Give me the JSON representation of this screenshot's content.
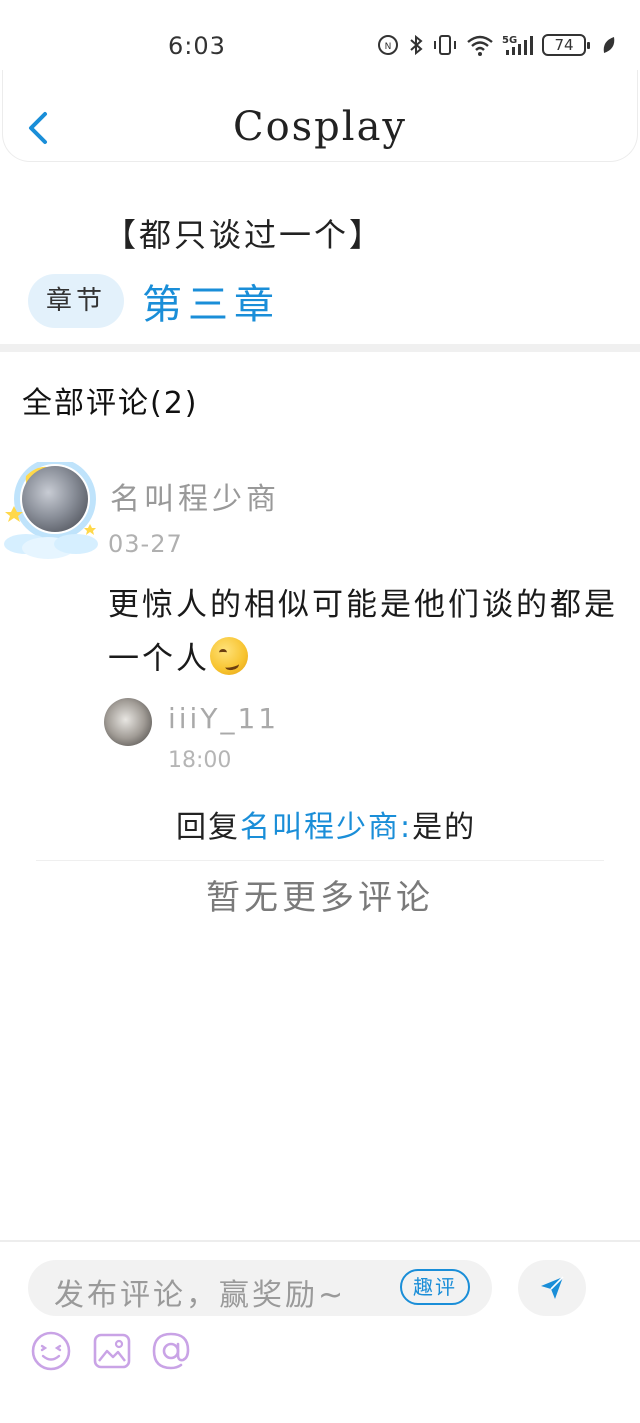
{
  "status_bar": {
    "time": "6:03",
    "battery": "74",
    "network": "5G"
  },
  "header": {
    "title": "Cosplay",
    "back_icon": "chevron-left-icon"
  },
  "book": {
    "title": "【都只谈过一个】",
    "chapter_tag": "章节",
    "chapter_name": "第三章"
  },
  "comments": {
    "header": "全部评论(2)",
    "items": [
      {
        "author": "名叫程少商",
        "date": "03-27",
        "text": "更惊人的相似可能是他们谈的都是一个人",
        "emoji": "smirk-emoji",
        "replies": [
          {
            "author": "iiiY_11",
            "time": "18:00",
            "prefix": "回复",
            "mention": "名叫程少商:",
            "text": "是的"
          }
        ]
      }
    ],
    "no_more": "暂无更多评论"
  },
  "composer": {
    "placeholder": "发布评论，赢奖励~",
    "badge": "趣评",
    "tools": [
      "emoji-icon",
      "image-icon",
      "at-icon"
    ]
  },
  "colors": {
    "accent": "#1a8ed8",
    "chapter_tag_bg": "#e3f1fb",
    "tool_icon": "#c9a3e6"
  }
}
